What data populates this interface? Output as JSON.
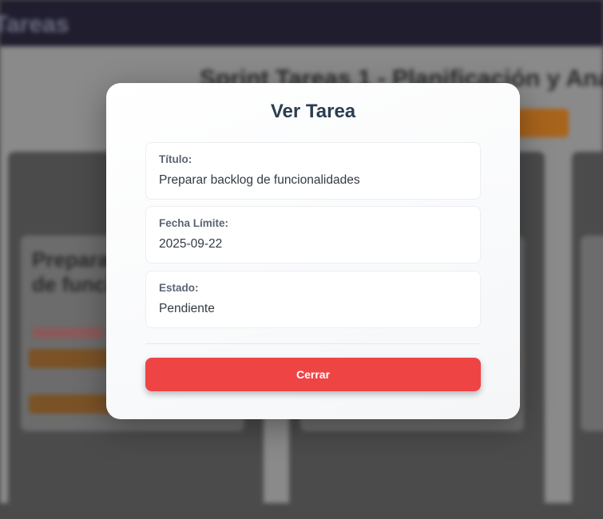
{
  "background": {
    "brand": "Tareas",
    "heading": "Sprint Tareas 1 - Planificación y Ana",
    "card_title": "Preparar backlog de funcionalidades"
  },
  "modal": {
    "title": "Ver Tarea",
    "fields": [
      {
        "label": "Título:",
        "value": "Preparar backlog de funcionalidades"
      },
      {
        "label": "Fecha Límite:",
        "value": "2025-09-22"
      },
      {
        "label": "Estado:",
        "value": "Pendiente"
      }
    ],
    "close_label": "Cerrar"
  },
  "colors": {
    "close_button": "#ef4444",
    "title_text": "#2c3e50",
    "topbar": "#1f1d2e"
  }
}
